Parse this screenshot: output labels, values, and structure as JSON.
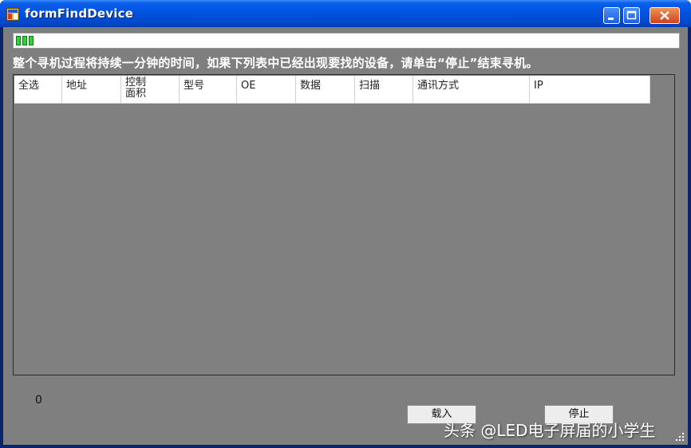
{
  "window": {
    "title": "formFindDevice"
  },
  "progress": {
    "blocks": 3
  },
  "info_text": "整个寻机过程将持续一分钟的时间，如果下列表中已经出现要找的设备，请单击“停止”结束寻机。",
  "columns": [
    {
      "label": "全选",
      "w": 60
    },
    {
      "label": "地址",
      "w": 74
    },
    {
      "label": "控制\n面积",
      "w": 73
    },
    {
      "label": "型号",
      "w": 72
    },
    {
      "label": "OE",
      "w": 74
    },
    {
      "label": "数据",
      "w": 74
    },
    {
      "label": "扫描",
      "w": 73
    },
    {
      "label": "通讯方式",
      "w": 146
    },
    {
      "label": "IP",
      "w": 151
    }
  ],
  "count_label": "0",
  "buttons": {
    "load": "载入",
    "stop": "停止"
  },
  "watermark": "头条 @LED电子屏届的小学生"
}
